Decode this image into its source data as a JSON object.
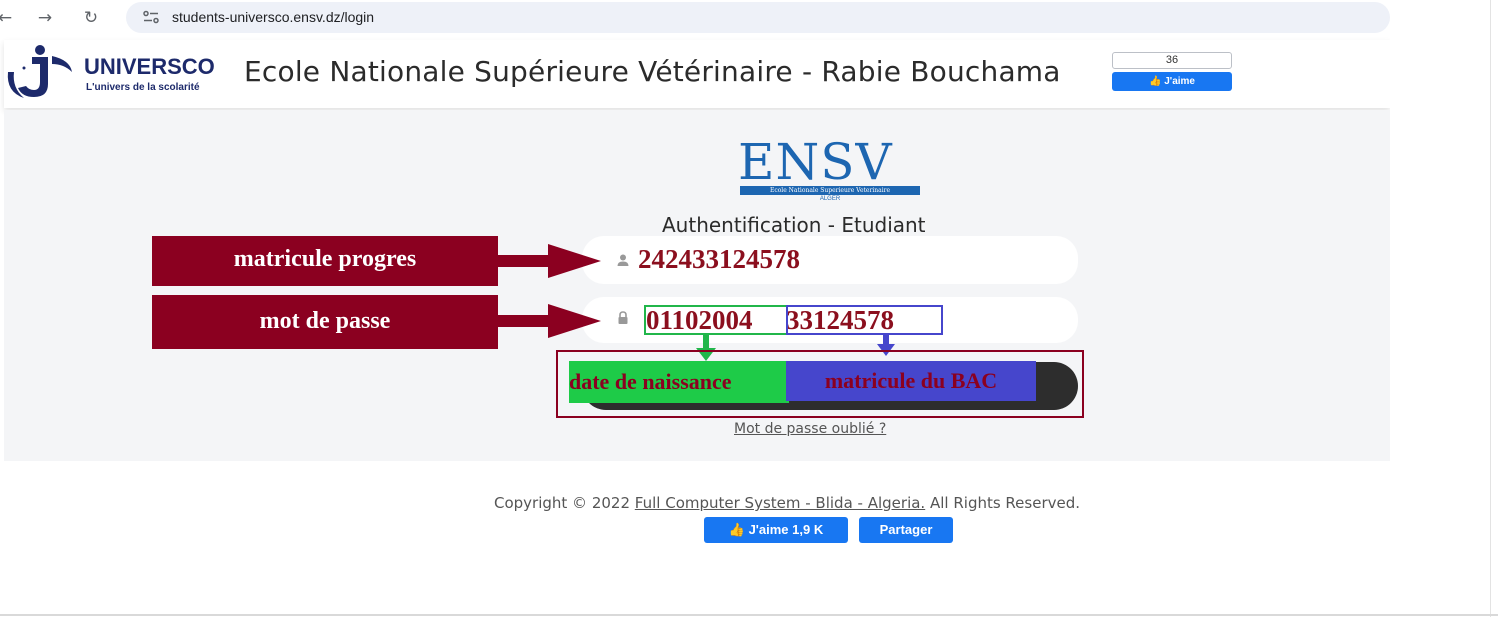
{
  "browser": {
    "back_icon": "back-arrow-icon",
    "forward_icon": "forward-arrow-icon",
    "reload_icon": "reload-icon",
    "url": "students-universco.ensv.dz/login"
  },
  "header": {
    "brand": "UNIVERSCO",
    "brand_tagline": "L'univers de la scolarité",
    "school_name": "Ecole Nationale Supérieure Vétérinaire - Rabie Bouchama",
    "fb_like_count": "36",
    "fb_like_label": "J'aime"
  },
  "login": {
    "logo_text": "ENSV",
    "logo_band": "Ecole Nationale Superieure Veterinaire",
    "logo_city": "ALGER",
    "title": "Authentification - Etudiant",
    "username_value": "242433124578",
    "password_part_date": "01102004",
    "password_part_bac": "33124578",
    "forgot_link": "Mot de passe oublié ?"
  },
  "annotations": {
    "callout_username": "matricule progres",
    "callout_password": "mot de passe",
    "tag_date": "date de naissance",
    "tag_bac": "matricule du BAC"
  },
  "footer": {
    "copyright_prefix": "Copyright © 2022",
    "copyright_link": "Full Computer System - Blida - Algeria.",
    "copyright_suffix": "All Rights Reserved.",
    "like_button": "J'aime 1,9 K",
    "share_button": "Partager"
  },
  "colors": {
    "annotation_red": "#8b0020",
    "highlight_green": "#1ecb48",
    "highlight_blue": "#4646cc",
    "facebook_blue": "#1877f2",
    "ensv_blue": "#1d66b1"
  }
}
